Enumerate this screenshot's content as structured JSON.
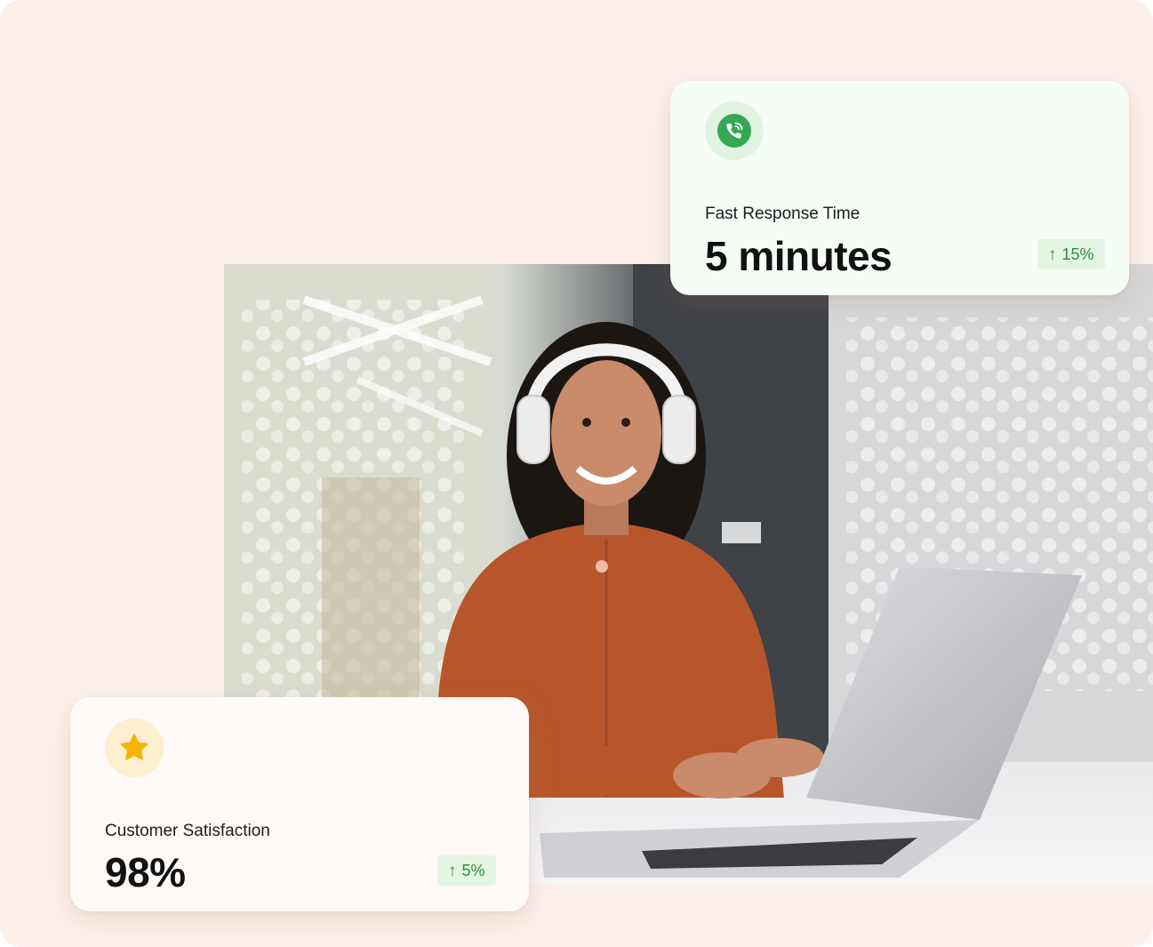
{
  "cards": {
    "response": {
      "icon": "phone-call-icon",
      "label": "Fast Response Time",
      "value": "5 minutes",
      "trend": "15%",
      "trend_direction": "up",
      "accent": "#34a853"
    },
    "satisfaction": {
      "icon": "star-icon",
      "label": "Customer Satisfaction",
      "value": "98%",
      "trend": "5%",
      "trend_direction": "up",
      "accent": "#f5b400"
    }
  },
  "colors": {
    "panel_background": "#fdf0eb",
    "trend_text": "#2f8f3a",
    "trend_background": "#e3f5e3"
  }
}
